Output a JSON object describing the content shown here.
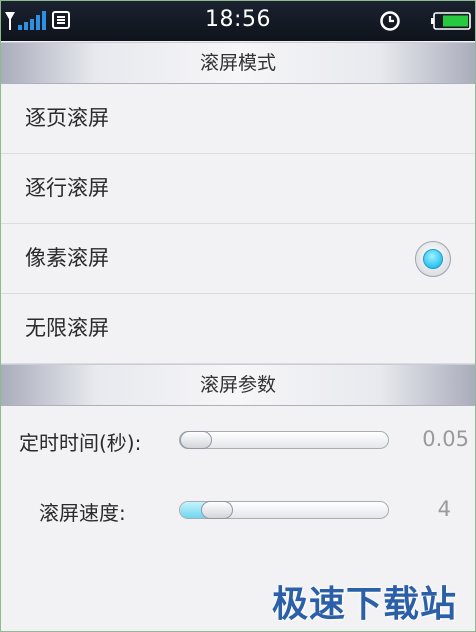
{
  "status_bar": {
    "time": "18:56",
    "signal_icon": "signal-bars-icon",
    "message_icon": "message-e-icon",
    "clock_icon": "alarm-clock-icon",
    "battery_icon": "battery-icon",
    "battery_color": "#27c93f"
  },
  "scroll_mode": {
    "header": "滚屏模式",
    "options": [
      {
        "label": "逐页滚屏",
        "selected": false
      },
      {
        "label": "逐行滚屏",
        "selected": false
      },
      {
        "label": "像素滚屏",
        "selected": true
      },
      {
        "label": "无限滚屏",
        "selected": false
      }
    ]
  },
  "scroll_params": {
    "header": "滚屏参数",
    "timer": {
      "label": "定时时间(秒):",
      "value": "0.05",
      "fraction": 0.0
    },
    "speed": {
      "label": "滚屏速度:",
      "value": "4",
      "fraction": 0.12
    }
  },
  "accent_color": "#2fc2f0",
  "watermark": "极速下载站"
}
